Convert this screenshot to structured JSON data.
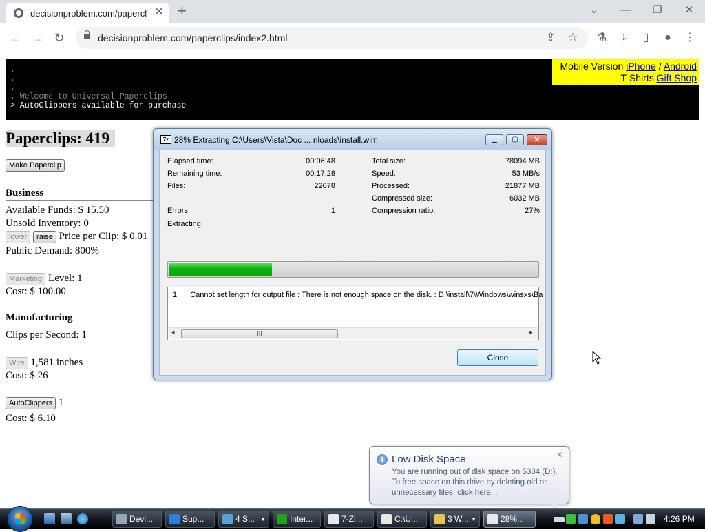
{
  "browser": {
    "tab_title": "decisionproblem.com/paperclips",
    "tab_close": "✕",
    "new_tab": "+",
    "url": "decisionproblem.com/paperclips/index2.html"
  },
  "console": {
    "lines": [
      ".",
      ".",
      ".",
      ". Welcome to Universal Paperclips",
      "> AutoClippers available for purchase"
    ]
  },
  "topright": {
    "mobile_label": "Mobile Version",
    "iphone": "iPhone",
    "sep": "/",
    "android": "Android",
    "tshirts": "T-Shirts",
    "giftshop": "Gift Shop"
  },
  "game": {
    "clips_label": "Paperclips: 419",
    "make_btn": "Make Paperclip",
    "business": {
      "heading": "Business",
      "funds": "Available Funds: $ 15.50",
      "inventory": "Unsold Inventory: 0",
      "lower": "lower",
      "raise": "raise",
      "price": "Price per Clip: $ 0.01",
      "demand": "Public Demand: 800%",
      "marketing_btn": "Marketing",
      "level": "Level: 1",
      "marketing_cost": "Cost: $ 100.00"
    },
    "manufacturing": {
      "heading": "Manufacturing",
      "cps": "Clips per Second: 1",
      "wire_btn": "Wire",
      "wire_amount": "1,581 inches",
      "wire_cost": "Cost: $ 26",
      "autoclippers_btn": "AutoClippers",
      "autoclippers_count": "1",
      "autoclippers_cost": "Cost: $ 6.10"
    }
  },
  "dialog": {
    "app_icon": "7z",
    "title": "28% Extracting C:\\Users\\Vista\\Doc ... nloads\\install.wim",
    "left": [
      {
        "label": "Elapsed time:",
        "value": "00:06:48"
      },
      {
        "label": "Remaining time:",
        "value": "00:17:28"
      },
      {
        "label": "Files:",
        "value": "22078"
      },
      {
        "label": "Errors:",
        "value": "1"
      }
    ],
    "right": [
      {
        "label": "Total size:",
        "value": "78094 MB"
      },
      {
        "label": "Speed:",
        "value": "53 MB/s"
      },
      {
        "label": "Processed:",
        "value": "21877 MB"
      },
      {
        "label": "Compressed size:",
        "value": "6032 MB"
      },
      {
        "label": "Compression ratio:",
        "value": "27%"
      }
    ],
    "status": "Extracting",
    "progress": 0.28,
    "log_num": "1",
    "log_text": "Cannot set length for output file : There is not enough space on the disk. : D:\\install\\7\\Windows\\winsxs\\Ba",
    "scroll_grip": "III",
    "close_label": "Close"
  },
  "balloon": {
    "title": "Low Disk Space",
    "message": "You are running out of disk space on 5384 (D:). To free space on this drive by deleting old or unnecessary files, click here...",
    "close": "✕"
  },
  "taskbar": {
    "buttons": [
      {
        "label": "Devi...",
        "color": "#9aa6b4"
      },
      {
        "label": "Sup...",
        "color": "#2f7fd6"
      },
      {
        "label": "4 S...",
        "color": "#5aa0d8"
      },
      {
        "label": "Inter...",
        "color": "#1fa21f"
      },
      {
        "label": "7-Zi...",
        "color": "#e8e8e8"
      },
      {
        "label": "C:\\U...",
        "color": "#e8e8e8"
      },
      {
        "label": "3 W...",
        "color": "#e8c454"
      },
      {
        "label": "28%...",
        "color": "#e8e8e8"
      }
    ],
    "clock": "4:26 PM"
  }
}
